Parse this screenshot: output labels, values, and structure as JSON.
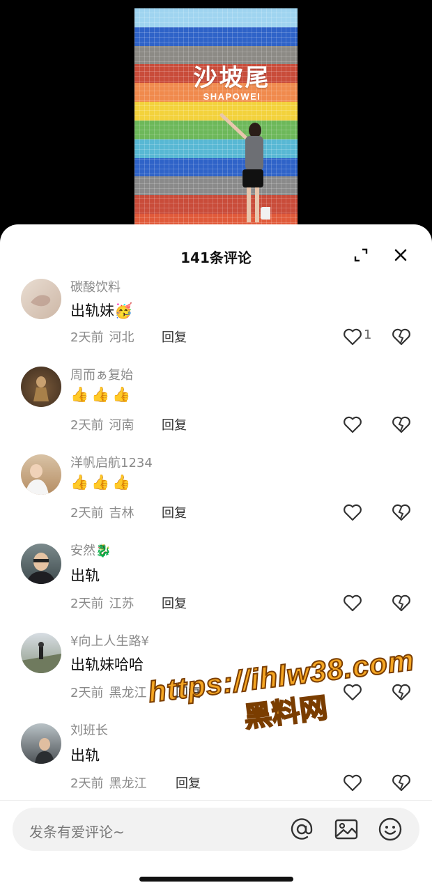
{
  "video": {
    "sign_cn": "沙坡尾",
    "sign_en": "SHAPOWEI",
    "stripe_colors": [
      "#9fd4f0",
      "#2f63c8",
      "#8c8a85",
      "#c94c3a",
      "#f08a4d",
      "#f3d23c",
      "#6db85a",
      "#58b8d4",
      "#2f63c8",
      "#8a8a8a",
      "#c94c3a",
      "#e05a3a"
    ]
  },
  "sheet": {
    "title": "141条评论",
    "expand_icon": "expand-icon",
    "close_icon": "close-icon"
  },
  "comments": [
    {
      "user": "碳酸饮料",
      "text": "出轨妹",
      "emoji": "🥳",
      "time": "2天前",
      "location": "河北",
      "reply": "回复",
      "likes": "1"
    },
    {
      "user": "周而ぁ复始",
      "text": "👍👍👍",
      "time": "2天前",
      "location": "河南",
      "reply": "回复",
      "likes": ""
    },
    {
      "user": "洋帆启航1234",
      "text": "👍👍👍",
      "time": "2天前",
      "location": "吉林",
      "reply": "回复",
      "likes": ""
    },
    {
      "user": "安然🐉",
      "text": "出轨",
      "time": "2天前",
      "location": "江苏",
      "reply": "回复",
      "likes": ""
    },
    {
      "user": "¥向上人生路¥",
      "text": "出轨妹哈哈",
      "time": "2天前",
      "location": "黑龙江",
      "reply": "回复",
      "likes": ""
    },
    {
      "user": "刘班长",
      "text": "出轨",
      "time": "2天前",
      "location": "黑龙江",
      "reply": "回复",
      "likes": ""
    }
  ],
  "input": {
    "placeholder": "发条有爱评论~",
    "icons": [
      "at-icon",
      "image-icon",
      "emoji-icon"
    ]
  },
  "watermark": {
    "url": "https://ihlw38.com",
    "label": "黑料网"
  }
}
